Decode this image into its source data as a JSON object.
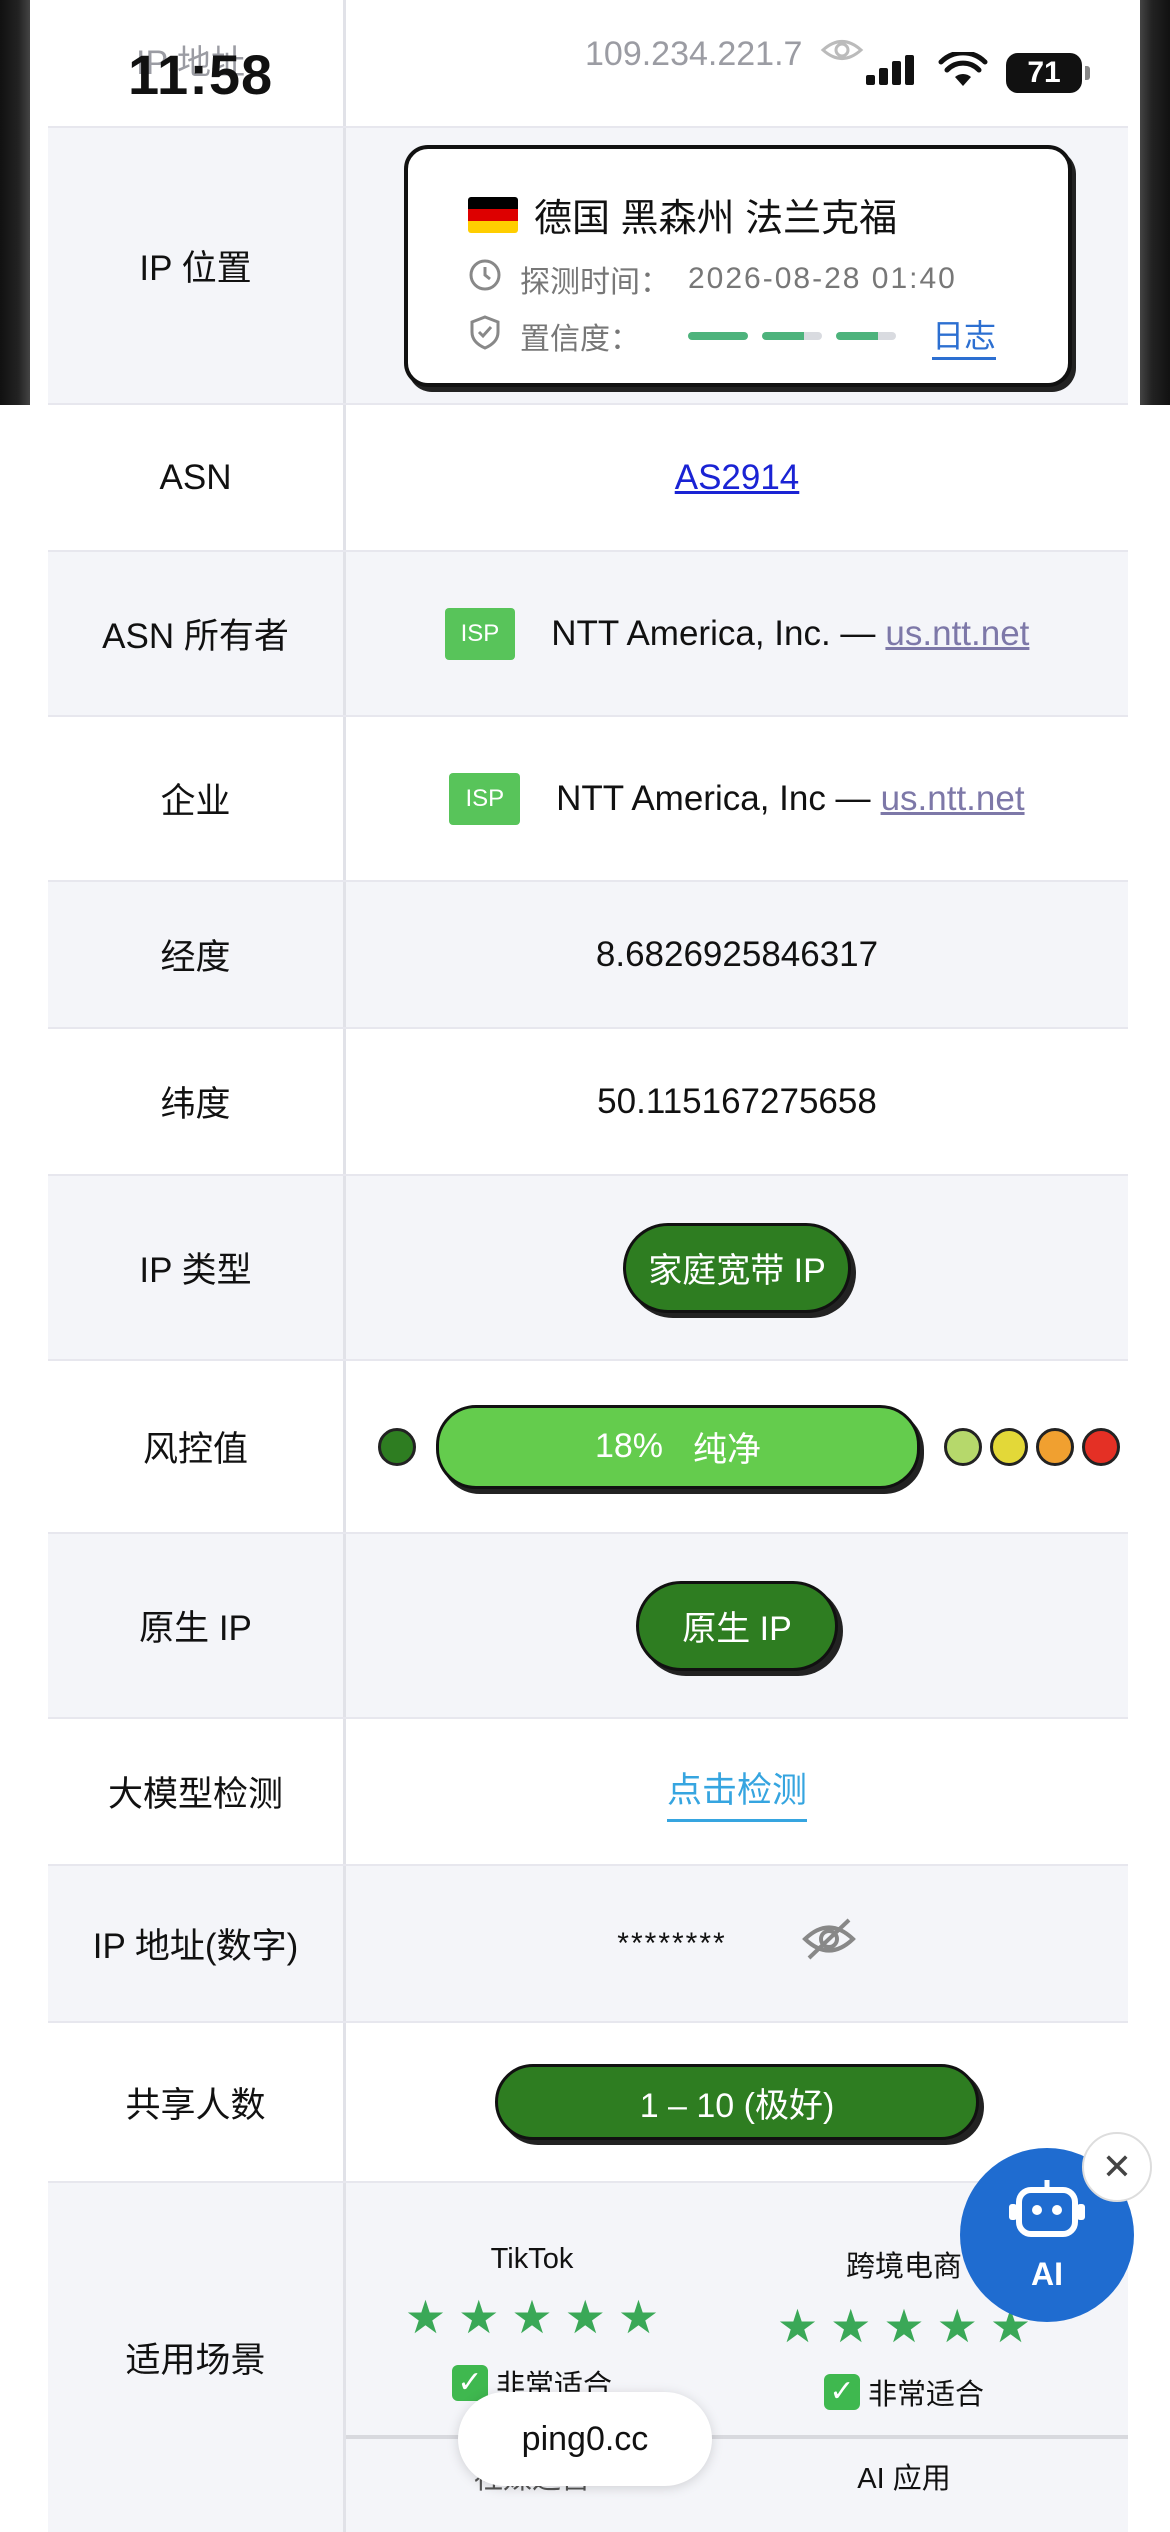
{
  "status_bar": {
    "time": "11:58",
    "battery": "71"
  },
  "rows": {
    "ip_address": {
      "label": "IP 地址",
      "value": "109.234.221.7"
    },
    "ip_location": {
      "label": "IP 位置",
      "location": "德国 黑森州 法兰克福",
      "detect_time_label": "探测时间：",
      "detect_time": "2026-08-28 01:40",
      "confidence_label": "置信度：",
      "log_link": "日志"
    },
    "asn": {
      "label": "ASN",
      "value": "AS2914"
    },
    "asn_owner": {
      "label": "ASN 所有者",
      "badge": "ISP",
      "name": "NTT America, Inc. —",
      "link": "us.ntt.net"
    },
    "enterprise": {
      "label": "企业",
      "badge": "ISP",
      "name": "NTT America, Inc —",
      "link": "us.ntt.net"
    },
    "longitude": {
      "label": "经度",
      "value": "8.6826925846317"
    },
    "latitude": {
      "label": "纬度",
      "value": "50.115167275658"
    },
    "ip_type": {
      "label": "IP 类型",
      "value": "家庭宽带 IP"
    },
    "risk": {
      "label": "风控值",
      "percent": "18%",
      "verdict": "纯净"
    },
    "native_ip": {
      "label": "原生 IP",
      "value": "原生 IP"
    },
    "llm_check": {
      "label": "大模型检测",
      "value": "点击检测"
    },
    "ip_numeric": {
      "label": "IP 地址(数字)",
      "value": "********"
    },
    "shared_users": {
      "label": "共享人数",
      "value": "1 – 10 (极好)"
    },
    "scenarios": {
      "label": "适用场景",
      "items": [
        {
          "name": "TikTok",
          "verdict": "非常适合"
        },
        {
          "name": "跨境电商",
          "verdict": "非常适合"
        },
        {
          "name": "社媒运营",
          "verdict": ""
        },
        {
          "name": "AI 应用",
          "verdict": ""
        }
      ]
    }
  },
  "footer": {
    "site": "ping0.cc",
    "ai_label": "AI"
  },
  "colors": {
    "green_dark": "#2e7d21",
    "green_light": "#64cc4d",
    "link_blue": "#1a23d4",
    "ai_blue": "#1f6cd0"
  }
}
